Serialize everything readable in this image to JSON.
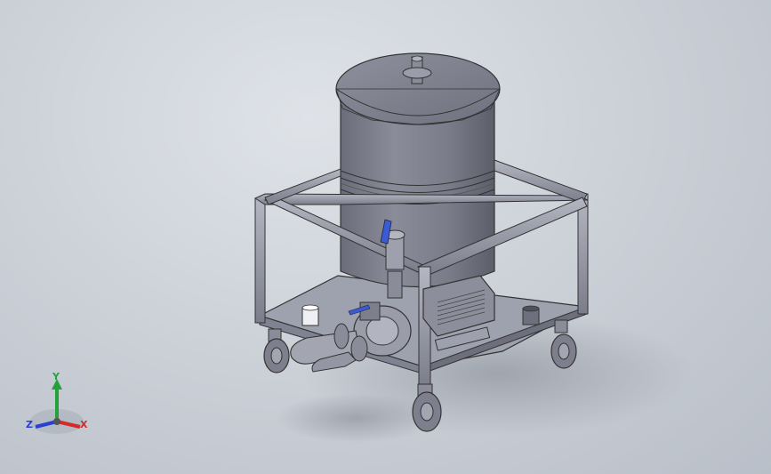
{
  "viewport": {
    "background": "#cdd2d9",
    "model_color": "#7d7f8c",
    "frame_color": "#9a9dab",
    "accent_color": "#3b5bd6"
  },
  "model": {
    "description_icon": "mixing-tank-cart-model"
  },
  "triad": {
    "x_label": "X",
    "y_label": "Y",
    "z_label": "Z",
    "x_color": "#d42a2a",
    "y_color": "#25a13a",
    "z_color": "#2a3fd4"
  }
}
